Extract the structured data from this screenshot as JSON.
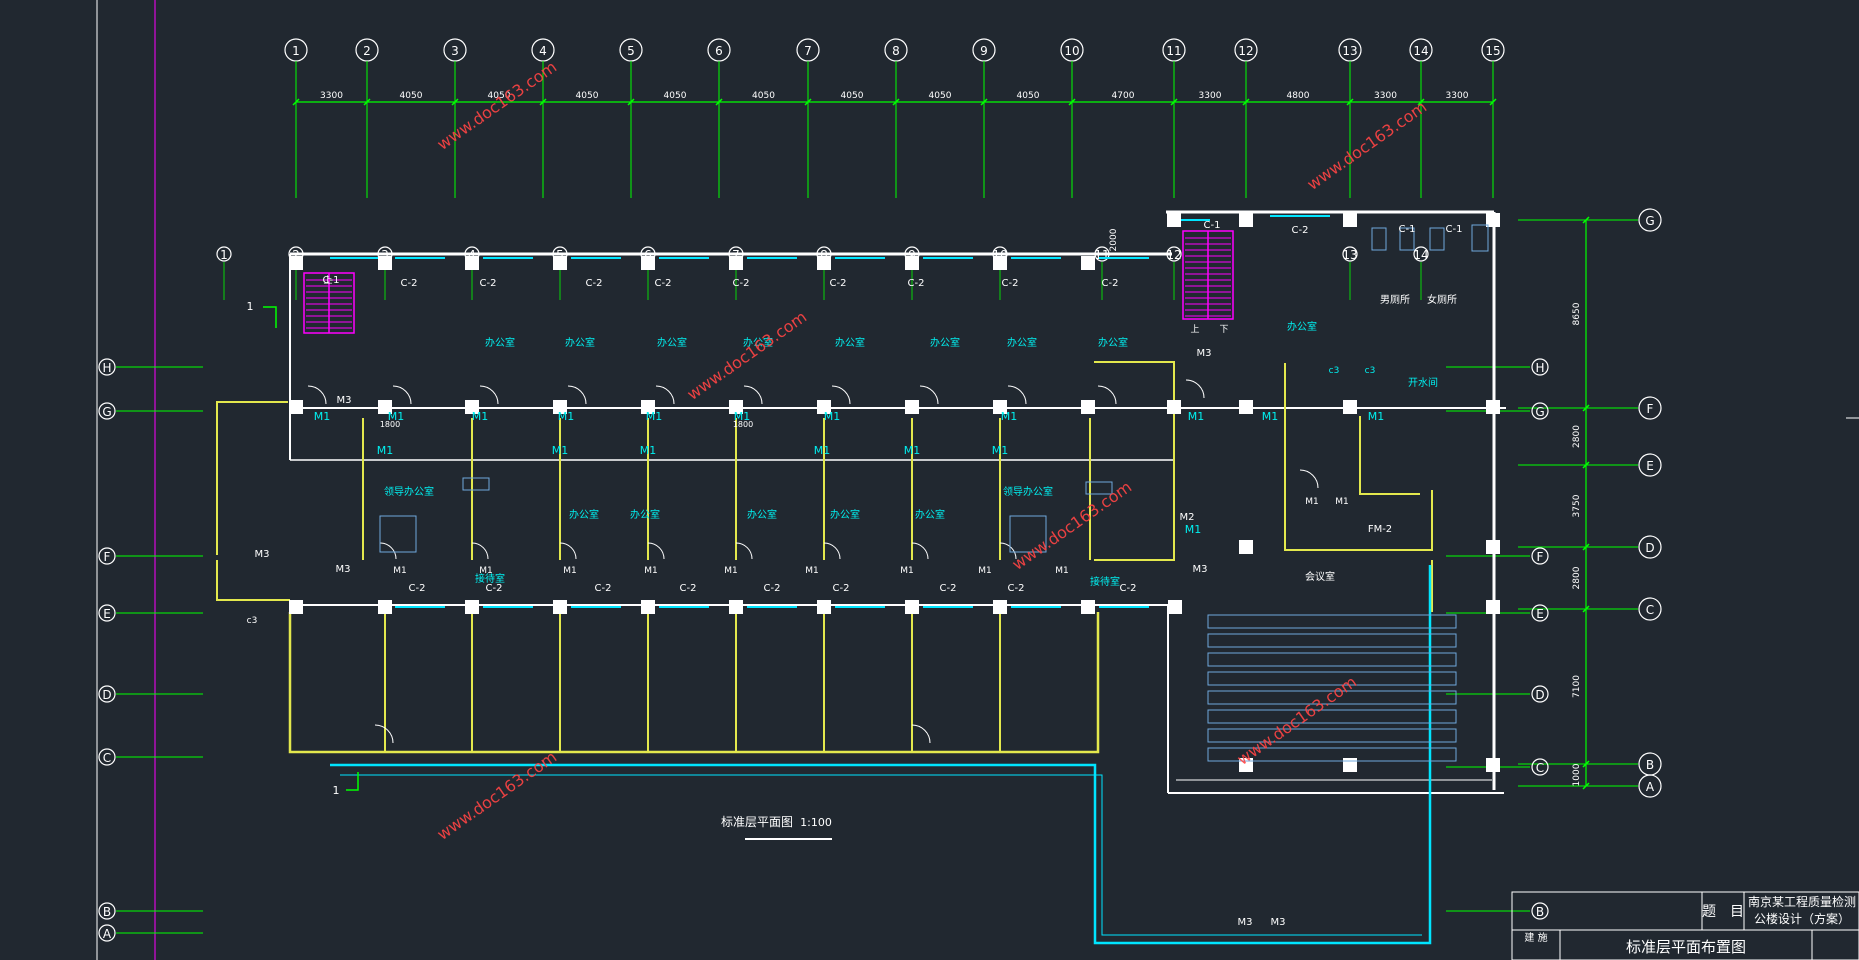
{
  "drawing": {
    "view_title": "标准层平面图",
    "view_scale": "1:100",
    "colors": {
      "background": "#212830",
      "axis": "#00ff00",
      "wall": "#ffffff",
      "partition": "#e3e84d",
      "glazing": "#00e5ff",
      "stair": "#ff00ff",
      "label": "#00f0f0",
      "watermark": "#ff4444",
      "furniture": "#6fa8dc"
    }
  },
  "top_axes": {
    "labels": [
      "1",
      "2",
      "3",
      "4",
      "5",
      "6",
      "7",
      "8",
      "9",
      "10",
      "11",
      "12",
      "13",
      "14",
      "15"
    ],
    "spacings": [
      "3300",
      "4050",
      "4050",
      "4050",
      "4050",
      "4050",
      "4050",
      "4050",
      "4050",
      "4700",
      "3300",
      "4800",
      "3300",
      "3300"
    ]
  },
  "right_axes": {
    "labels": [
      "G",
      "F",
      "E",
      "D",
      "C",
      "B",
      "A"
    ],
    "spacings": [
      "8650",
      "2800",
      "3750",
      "2800",
      "7100",
      "1000"
    ]
  },
  "left_axes": {
    "labels": [
      "H",
      "G",
      "F",
      "E",
      "D",
      "C",
      "B",
      "A"
    ]
  },
  "inner_axes": {
    "labels": [
      "H",
      "G",
      "F",
      "E",
      "D",
      "C",
      "B"
    ]
  },
  "plan_axes": {
    "labels": [
      "1",
      "2",
      "3",
      "4",
      "5",
      "6",
      "7",
      "8",
      "9",
      "10",
      "11",
      "12",
      "13",
      "14"
    ]
  },
  "labels": {
    "c1": "C-1",
    "c2": "C-2",
    "c3": "c3",
    "m1": "M1",
    "m2": "M2",
    "m3": "M3",
    "fm2": "FM-2",
    "office": "办公室",
    "leader_office": "领导办公室",
    "reception": "接待室",
    "male_wc": "男厕所",
    "female_wc": "女厕所",
    "janitor": "开水间",
    "hall": "会议室",
    "up": "上",
    "down": "下",
    "dim_2000": "2000",
    "dim_1800": "1800",
    "section_mark": "1"
  },
  "title_block": {
    "field_label": "题　目",
    "project_line1": "南京某工程质量检测",
    "project_line2": "公楼设计（方案）",
    "sheet_title": "标准层平面布置图",
    "sheet_no": "建 施"
  },
  "watermark": "www.doc163.com"
}
